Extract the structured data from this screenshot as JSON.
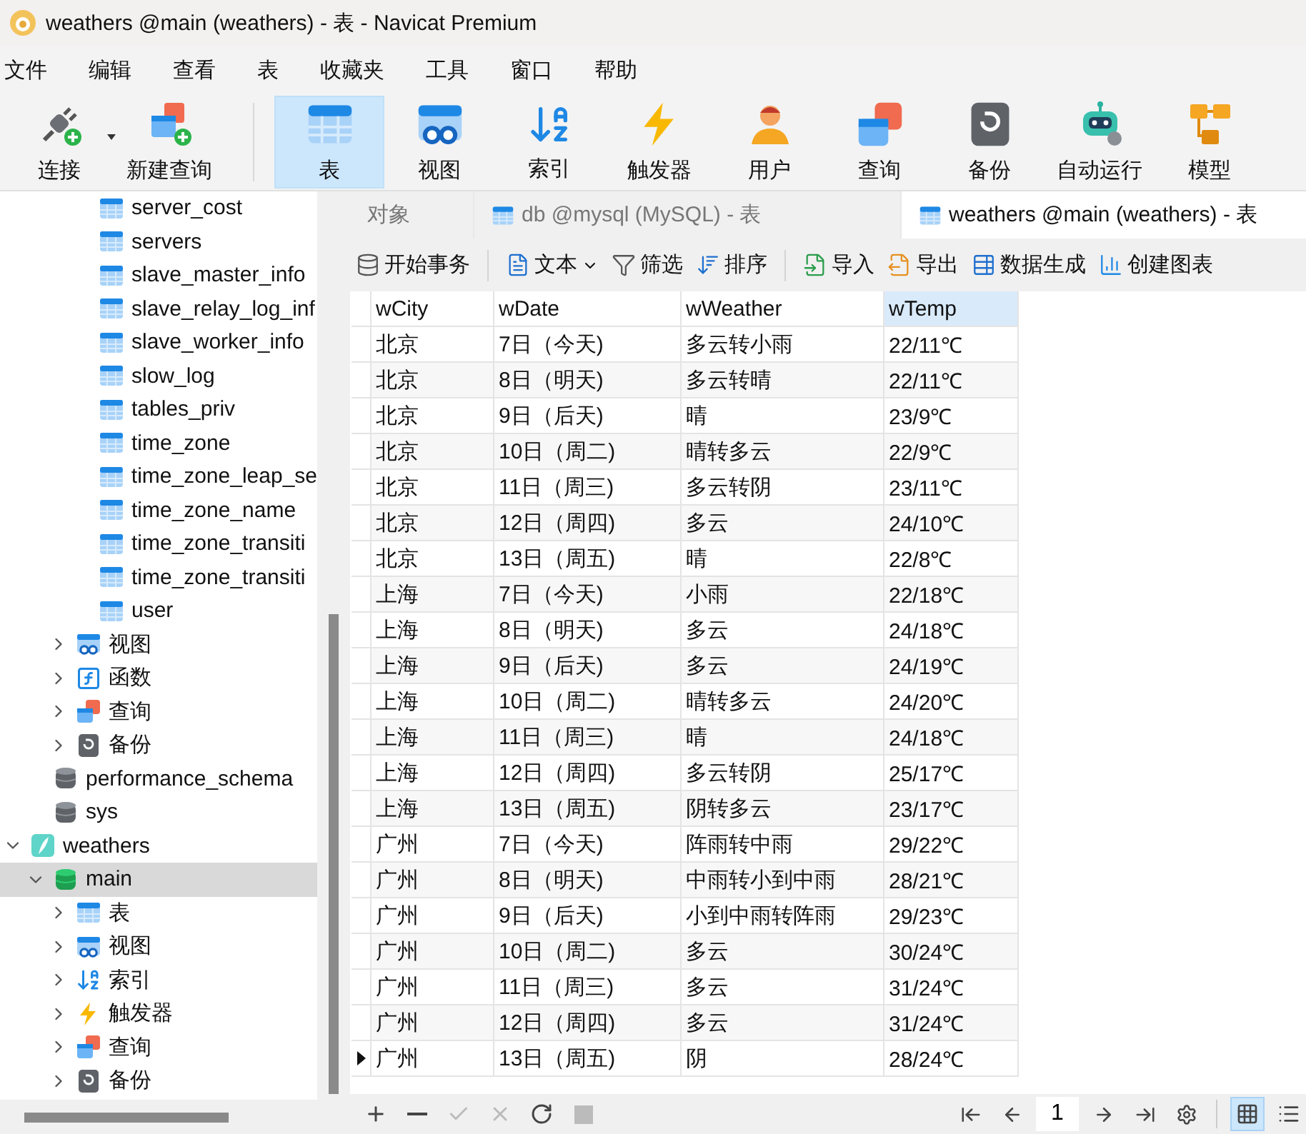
{
  "window": {
    "title": "weathers @main (weathers) - 表 - Navicat Premium"
  },
  "menu": [
    "文件",
    "编辑",
    "查看",
    "表",
    "收藏夹",
    "工具",
    "窗口",
    "帮助"
  ],
  "toolbar": [
    {
      "label": "连接",
      "kind": "connect",
      "selected": false,
      "dropdown": true
    },
    {
      "label": "新建查询",
      "kind": "newquery",
      "selected": false,
      "dropdown": false
    },
    {
      "label": "表",
      "kind": "table",
      "selected": true,
      "dropdown": false
    },
    {
      "label": "视图",
      "kind": "view",
      "selected": false,
      "dropdown": false
    },
    {
      "label": "索引",
      "kind": "index",
      "selected": false,
      "dropdown": false
    },
    {
      "label": "触发器",
      "kind": "trigger",
      "selected": false,
      "dropdown": false
    },
    {
      "label": "用户",
      "kind": "user",
      "selected": false,
      "dropdown": false
    },
    {
      "label": "查询",
      "kind": "query",
      "selected": false,
      "dropdown": false
    },
    {
      "label": "备份",
      "kind": "backup",
      "selected": false,
      "dropdown": false
    },
    {
      "label": "自动运行",
      "kind": "robot",
      "selected": false,
      "dropdown": false
    },
    {
      "label": "模型",
      "kind": "model",
      "selected": false,
      "dropdown": false
    }
  ],
  "sidebar": {
    "mysql_tables": [
      {
        "label": "server_cost",
        "kind": "table",
        "selected": false
      },
      {
        "label": "servers",
        "kind": "table",
        "selected": false
      },
      {
        "label": "slave_master_info",
        "kind": "table",
        "selected": false
      },
      {
        "label": "slave_relay_log_inf",
        "kind": "table",
        "selected": false
      },
      {
        "label": "slave_worker_info",
        "kind": "table",
        "selected": false
      },
      {
        "label": "slow_log",
        "kind": "table",
        "selected": false
      },
      {
        "label": "tables_priv",
        "kind": "table",
        "selected": false
      },
      {
        "label": "time_zone",
        "kind": "table",
        "selected": false
      },
      {
        "label": "time_zone_leap_se",
        "kind": "table",
        "selected": false
      },
      {
        "label": "time_zone_name",
        "kind": "table",
        "selected": false
      },
      {
        "label": "time_zone_transiti",
        "kind": "table",
        "selected": false
      },
      {
        "label": "time_zone_transiti",
        "kind": "table",
        "selected": false
      },
      {
        "label": "user",
        "kind": "table",
        "selected": false
      }
    ],
    "mysql_groups": [
      {
        "label": "视图",
        "kind": "view",
        "expanded": false,
        "selected": false
      },
      {
        "label": "函数",
        "kind": "function",
        "expanded": false,
        "selected": false
      },
      {
        "label": "查询",
        "kind": "query",
        "expanded": false,
        "selected": false
      },
      {
        "label": "备份",
        "kind": "backup",
        "expanded": false,
        "selected": false
      }
    ],
    "databases": [
      {
        "label": "performance_schema",
        "kind": "database",
        "selected": false
      },
      {
        "label": "sys",
        "kind": "database",
        "selected": false
      }
    ],
    "connections": [
      {
        "label": "weathers",
        "kind": "sqlite",
        "expanded": true,
        "selected": false,
        "children": [
          {
            "label": "main",
            "kind": "schema",
            "expanded": true,
            "selected": true,
            "children": [
              {
                "label": "表",
                "kind": "table",
                "expanded": false,
                "selected": false
              },
              {
                "label": "视图",
                "kind": "view",
                "expanded": false,
                "selected": false
              },
              {
                "label": "索引",
                "kind": "index",
                "expanded": false,
                "selected": false
              },
              {
                "label": "触发器",
                "kind": "trigger",
                "expanded": false,
                "selected": false
              },
              {
                "label": "查询",
                "kind": "query",
                "expanded": false,
                "selected": false
              },
              {
                "label": "备份",
                "kind": "backup",
                "expanded": false,
                "selected": false
              }
            ]
          }
        ]
      }
    ]
  },
  "tabs": [
    {
      "label": "对象",
      "icon": false,
      "selected": false
    },
    {
      "label": "db @mysql (MySQL) - 表",
      "icon": true,
      "selected": false
    },
    {
      "label": "weathers @main (weathers) - 表",
      "icon": true,
      "selected": true
    }
  ],
  "actions": [
    {
      "label": "开始事务",
      "kind": "transaction",
      "group_end": true
    },
    {
      "label": "文本",
      "kind": "text",
      "dropdown": true
    },
    {
      "label": "筛选",
      "kind": "filter"
    },
    {
      "label": "排序",
      "kind": "sort",
      "group_end": true
    },
    {
      "label": "导入",
      "kind": "import"
    },
    {
      "label": "导出",
      "kind": "export"
    },
    {
      "label": "数据生成",
      "kind": "generate"
    },
    {
      "label": "创建图表",
      "kind": "chart"
    }
  ],
  "table": {
    "columns": [
      {
        "label": "wCity",
        "selected": false
      },
      {
        "label": "wDate",
        "selected": false
      },
      {
        "label": "wWeather",
        "selected": false
      },
      {
        "label": "wTemp",
        "selected": true
      }
    ],
    "rows": [
      {
        "cells": [
          "北京",
          "7日（今天)",
          "多云转小雨",
          "22/11℃"
        ],
        "current": false
      },
      {
        "cells": [
          "北京",
          "8日（明天)",
          "多云转晴",
          "22/11℃"
        ],
        "current": false
      },
      {
        "cells": [
          "北京",
          "9日（后天)",
          "晴",
          "23/9℃"
        ],
        "current": false
      },
      {
        "cells": [
          "北京",
          "10日（周二)",
          "晴转多云",
          "22/9℃"
        ],
        "current": false
      },
      {
        "cells": [
          "北京",
          "11日（周三)",
          "多云转阴",
          "23/11℃"
        ],
        "current": false
      },
      {
        "cells": [
          "北京",
          "12日（周四)",
          "多云",
          "24/10℃"
        ],
        "current": false
      },
      {
        "cells": [
          "北京",
          "13日（周五)",
          "晴",
          "22/8℃"
        ],
        "current": false
      },
      {
        "cells": [
          "上海",
          "7日（今天)",
          "小雨",
          "22/18℃"
        ],
        "current": false
      },
      {
        "cells": [
          "上海",
          "8日（明天)",
          "多云",
          "24/18℃"
        ],
        "current": false
      },
      {
        "cells": [
          "上海",
          "9日（后天)",
          "多云",
          "24/19℃"
        ],
        "current": false
      },
      {
        "cells": [
          "上海",
          "10日（周二)",
          "晴转多云",
          "24/20℃"
        ],
        "current": false
      },
      {
        "cells": [
          "上海",
          "11日（周三)",
          "晴",
          "24/18℃"
        ],
        "current": false
      },
      {
        "cells": [
          "上海",
          "12日（周四)",
          "多云转阴",
          "25/17℃"
        ],
        "current": false
      },
      {
        "cells": [
          "上海",
          "13日（周五)",
          "阴转多云",
          "23/17℃"
        ],
        "current": false
      },
      {
        "cells": [
          "广州",
          "7日（今天)",
          "阵雨转中雨",
          "29/22℃"
        ],
        "current": false
      },
      {
        "cells": [
          "广州",
          "8日（明天)",
          "中雨转小到中雨",
          "28/21℃"
        ],
        "current": false
      },
      {
        "cells": [
          "广州",
          "9日（后天)",
          "小到中雨转阵雨",
          "29/23℃"
        ],
        "current": false
      },
      {
        "cells": [
          "广州",
          "10日（周二)",
          "多云",
          "30/24℃"
        ],
        "current": false
      },
      {
        "cells": [
          "广州",
          "11日（周三)",
          "多云",
          "31/24℃"
        ],
        "current": false
      },
      {
        "cells": [
          "广州",
          "12日（周四)",
          "多云",
          "31/24℃"
        ],
        "current": false
      },
      {
        "cells": [
          "广州",
          "13日（周五)",
          "阴",
          "28/24℃"
        ],
        "current": true
      }
    ]
  },
  "status_bar": {
    "edit_buttons": [
      {
        "kind": "add",
        "disabled": false
      },
      {
        "kind": "remove",
        "disabled": false
      },
      {
        "kind": "apply",
        "disabled": true
      },
      {
        "kind": "discard",
        "disabled": true
      },
      {
        "kind": "refresh",
        "disabled": false
      },
      {
        "kind": "stop",
        "disabled": true
      }
    ],
    "pager": {
      "page": "1"
    },
    "views": [
      {
        "kind": "grid",
        "selected": true
      },
      {
        "kind": "form",
        "selected": false
      }
    ]
  }
}
